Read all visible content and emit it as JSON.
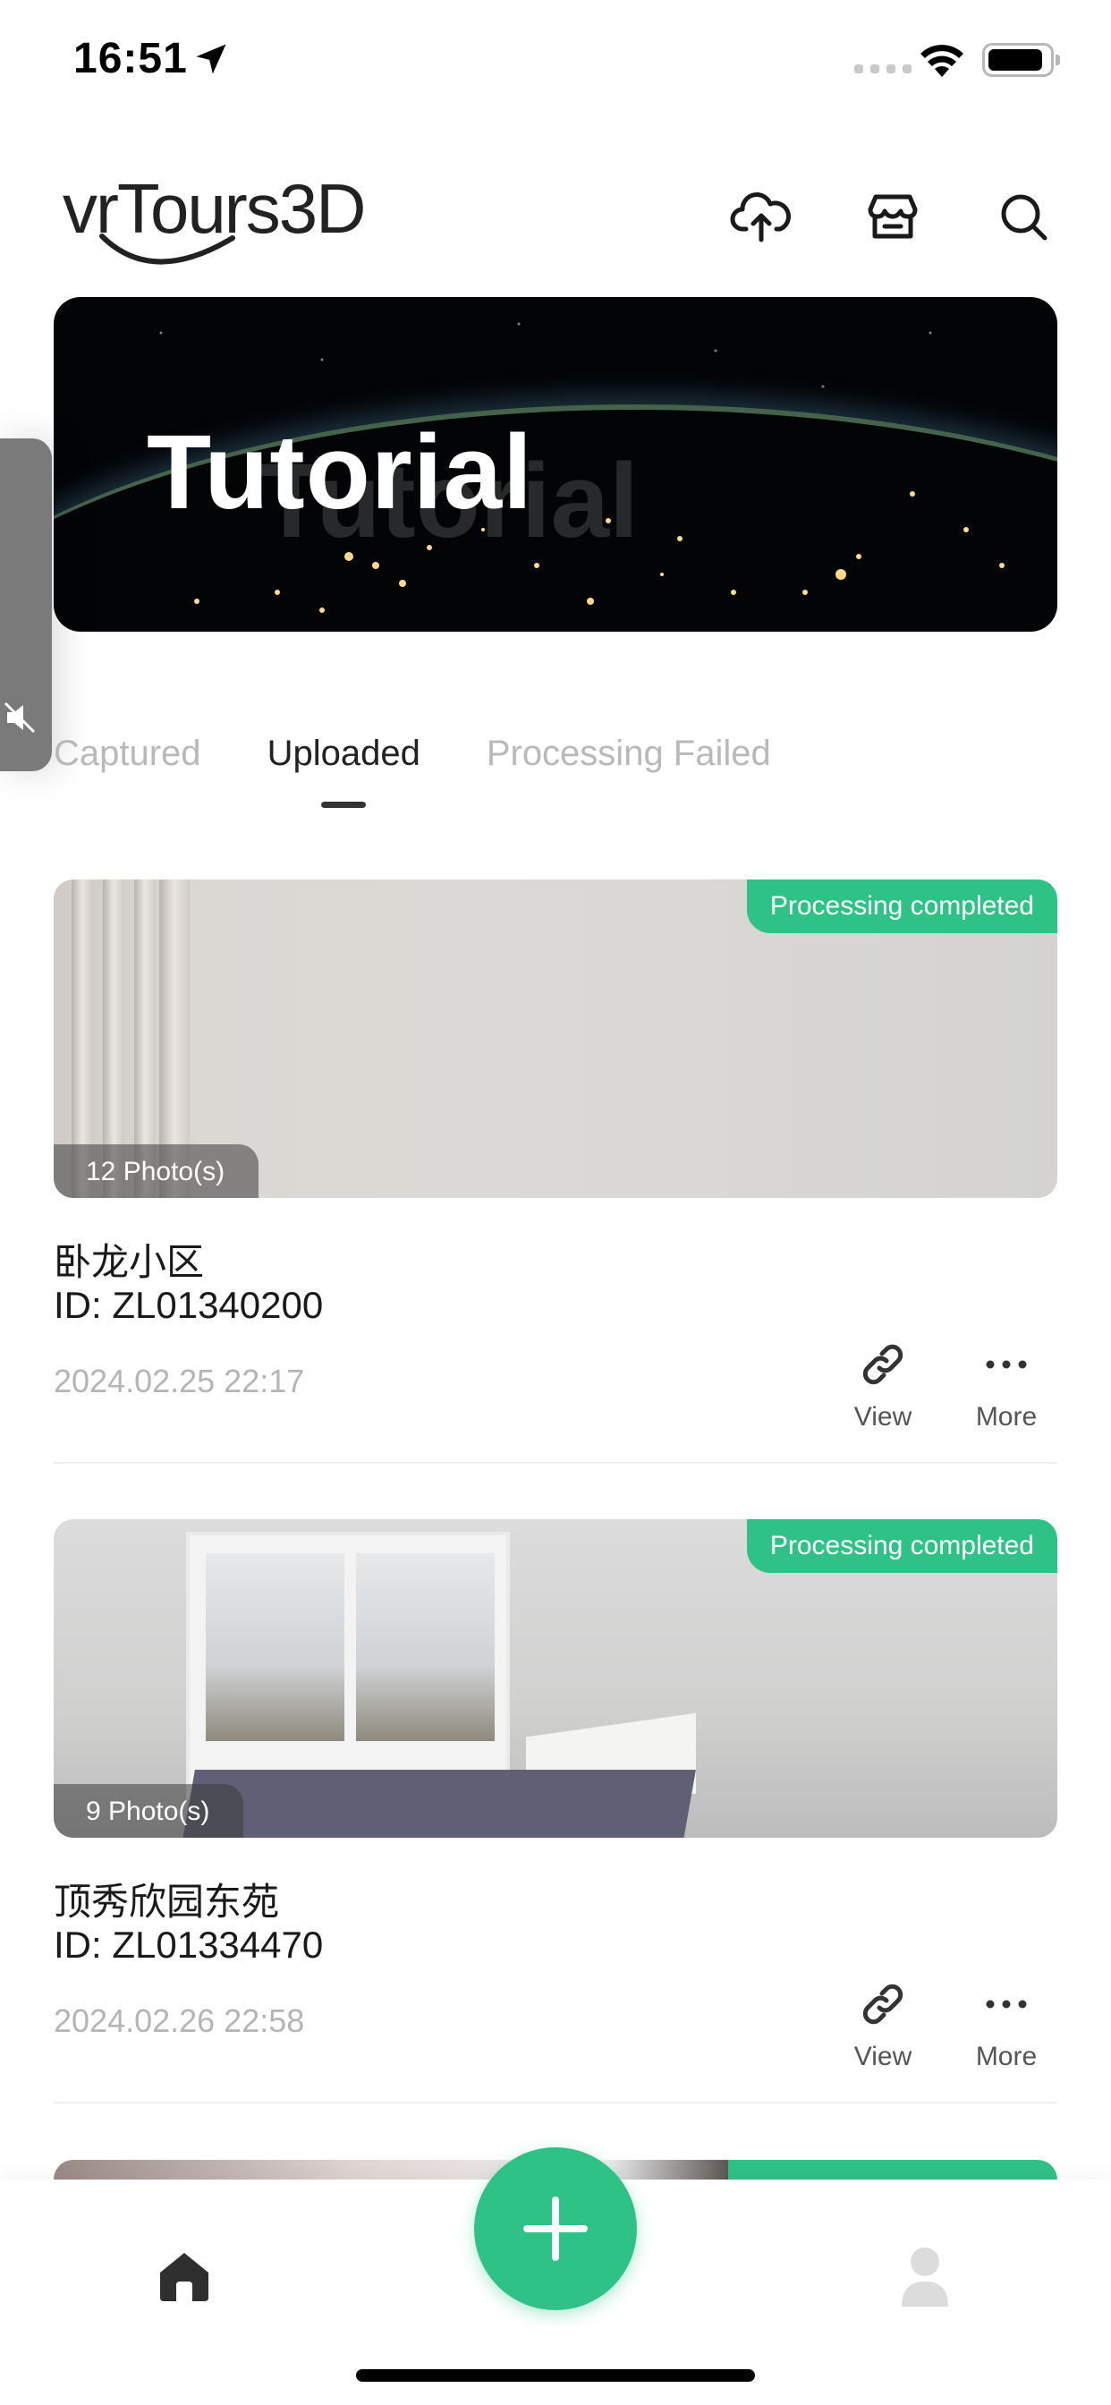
{
  "status_bar": {
    "time": "16:51"
  },
  "header": {
    "logo_text": "vrTours3D",
    "upload_icon": "cloud-upload-icon",
    "store_icon": "store-icon",
    "search_icon": "search-icon"
  },
  "banner": {
    "title": "Tutorial"
  },
  "tabs": [
    {
      "label": "Captured"
    },
    {
      "label": "Uploaded"
    },
    {
      "label": "Processing Failed"
    }
  ],
  "active_tab": "Uploaded",
  "cards": [
    {
      "status": "Processing completed",
      "photos": "12 Photo(s)",
      "name": "卧龙小区",
      "id": "ID: ZL01340200",
      "date": "2024.02.25 22:17",
      "view_label": "View",
      "more_label": "More"
    },
    {
      "status": "Processing completed",
      "photos": "9 Photo(s)",
      "name": "顶秀欣园东苑",
      "id": "ID: ZL01334470",
      "date": "2024.02.26 22:58",
      "view_label": "View",
      "more_label": "More"
    }
  ],
  "colors": {
    "accent": "#2fc286",
    "inactive_tab": "#b9b9b9",
    "date_text": "#b5b5b5"
  }
}
